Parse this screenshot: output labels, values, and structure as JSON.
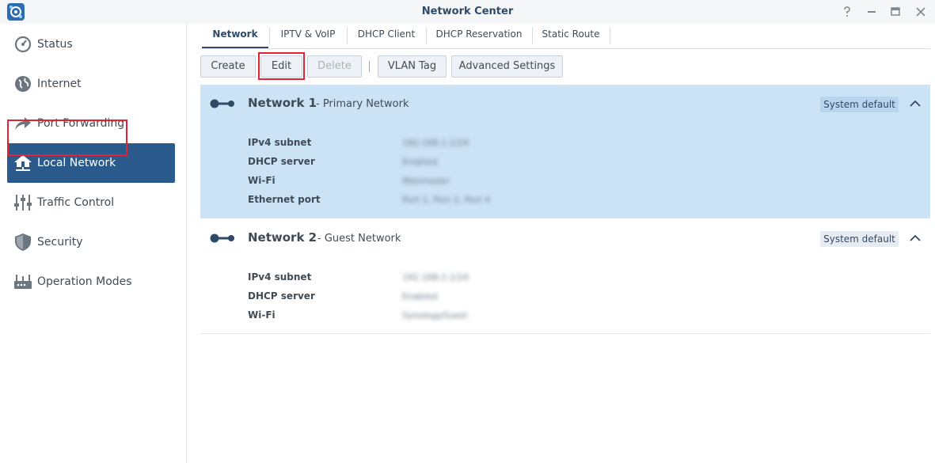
{
  "window": {
    "title": "Network Center",
    "app_icon": "network-center-app-icon",
    "controls": [
      "help-icon",
      "minimize-icon",
      "maximize-icon",
      "close-icon"
    ]
  },
  "sidebar": {
    "items": [
      {
        "label": "Status",
        "icon": "gauge-icon"
      },
      {
        "label": "Internet",
        "icon": "globe-icon"
      },
      {
        "label": "Port Forwarding",
        "icon": "forward-arrow-icon"
      },
      {
        "label": "Local Network",
        "icon": "home-network-icon",
        "active": true
      },
      {
        "label": "Traffic Control",
        "icon": "sliders-icon"
      },
      {
        "label": "Security",
        "icon": "shield-icon"
      },
      {
        "label": "Operation Modes",
        "icon": "router-icon"
      }
    ],
    "active_color": "#2b5a8c"
  },
  "tabs": [
    {
      "label": "Network",
      "active": true
    },
    {
      "label": "IPTV & VoIP"
    },
    {
      "label": "DHCP Client"
    },
    {
      "label": "DHCP Reservation"
    },
    {
      "label": "Static Route"
    }
  ],
  "toolbar": {
    "create": "Create",
    "edit": "Edit",
    "delete": "Delete",
    "vlan": "VLAN Tag",
    "advanced": "Advanced Settings"
  },
  "networks": [
    {
      "name": "Network 1",
      "subtitle": "- Primary Network",
      "badge": "System default",
      "selected": true,
      "props": [
        {
          "label": "IPv4 subnet",
          "value": "192.168.1.1/24"
        },
        {
          "label": "DHCP server",
          "value": "Enabled"
        },
        {
          "label": "Wi-Fi",
          "value": "Mainrouter"
        },
        {
          "label": "Ethernet port",
          "value": "Port 1, Port 2, Port 4"
        }
      ]
    },
    {
      "name": "Network 2",
      "subtitle": "- Guest Network",
      "badge": "System default",
      "selected": false,
      "props": [
        {
          "label": "IPv4 subnet",
          "value": "192.168.2.1/24"
        },
        {
          "label": "DHCP server",
          "value": "Enabled"
        },
        {
          "label": "Wi-Fi",
          "value": "SynologyGuest"
        }
      ]
    }
  ],
  "colors": {
    "selected_panel": "#cce2f5",
    "highlight": "#e32235",
    "title": "#2f4a68"
  }
}
